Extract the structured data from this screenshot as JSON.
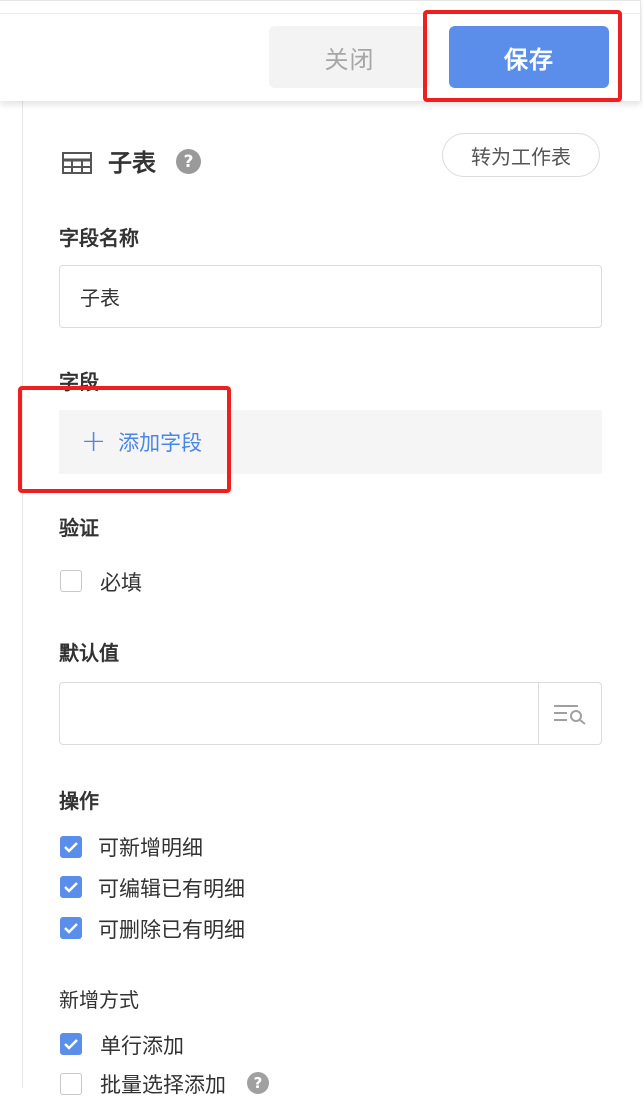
{
  "toolbar": {
    "close_label": "关闭",
    "save_label": "保存"
  },
  "panel": {
    "title": "子表",
    "help_icon": "?",
    "convert_label": "转为工作表",
    "field_name_label": "字段名称",
    "field_name_value": "子表",
    "fields_label": "字段",
    "add_field_label": "添加字段",
    "validation_label": "验证",
    "required_label": "必填",
    "default_label": "默认值",
    "default_value": "",
    "operations_label": "操作",
    "operations": [
      {
        "label": "可新增明细",
        "checked": true
      },
      {
        "label": "可编辑已有明细",
        "checked": true
      },
      {
        "label": "可删除已有明细",
        "checked": true
      }
    ],
    "add_mode_label": "新增方式",
    "add_modes": [
      {
        "label": "单行添加",
        "checked": true
      },
      {
        "label": "批量选择添加",
        "checked": false
      }
    ]
  },
  "colors": {
    "primary": "#5a8eea",
    "link": "#4a86e8",
    "highlight": "#f01f1f"
  },
  "icons": [
    "table-grid-icon",
    "help-icon",
    "plus-icon",
    "list-search-icon",
    "check-icon"
  ]
}
